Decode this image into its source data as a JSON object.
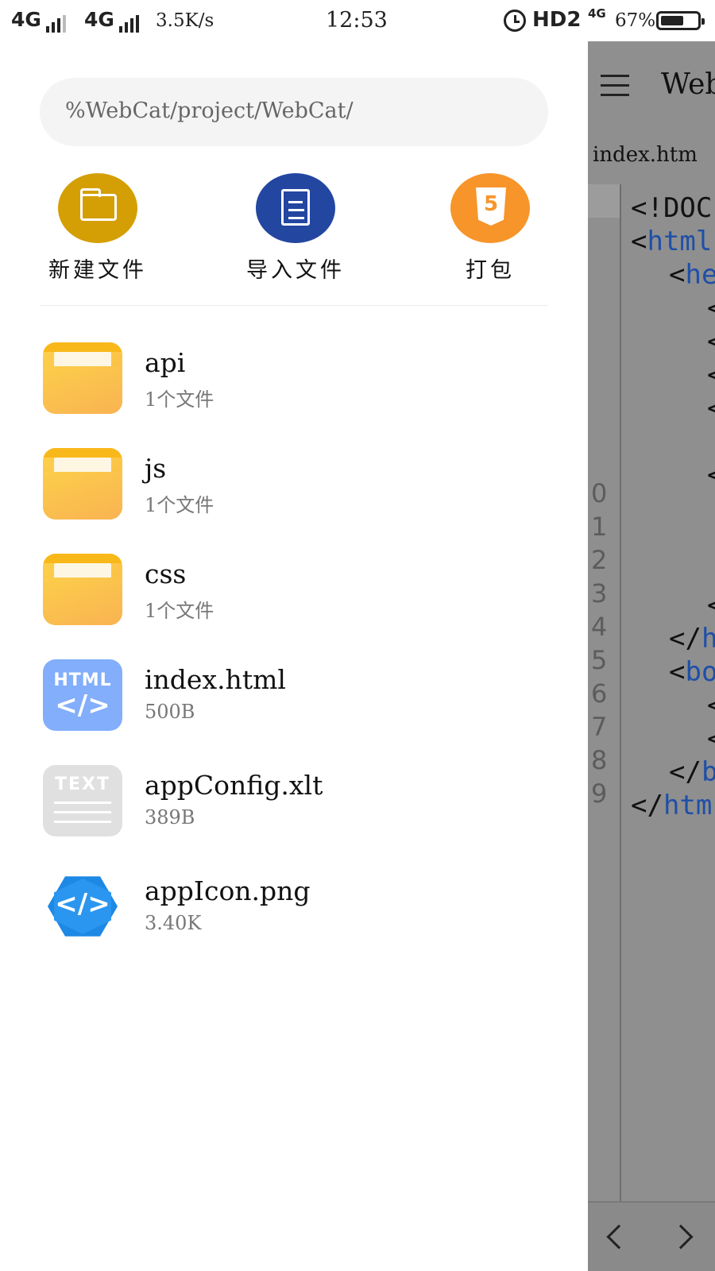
{
  "status_bar": {
    "network_left": "4G",
    "network_right": "4G",
    "speed": "3.5K/s",
    "time": "12:53",
    "hd_label": "HD2",
    "net_small": "4G",
    "battery": "67%"
  },
  "editor": {
    "title": "Web",
    "tab": "index.htm",
    "code_lines": [
      {
        "text": "<!DOC",
        "kind": "plain"
      },
      {
        "text": "<html",
        "kind": "tag"
      },
      {
        "text": "<he",
        "kind": "tag"
      },
      {
        "text": "<",
        "kind": "plain"
      },
      {
        "text": "<",
        "kind": "plain"
      },
      {
        "text": "<",
        "kind": "plain"
      },
      {
        "text": "<",
        "kind": "plain"
      },
      {
        "text": "<",
        "kind": "plain"
      },
      {
        "text": "<",
        "kind": "plain"
      },
      {
        "text": "</h",
        "kind": "tag"
      },
      {
        "text": "<bo",
        "kind": "tag"
      },
      {
        "text": "<",
        "kind": "plain"
      },
      {
        "text": "<",
        "kind": "plain"
      },
      {
        "text": "</b",
        "kind": "tag"
      },
      {
        "text": "</htm",
        "kind": "tag"
      }
    ],
    "line_numbers": [
      "0",
      "1",
      "2",
      "3",
      "4",
      "5",
      "6",
      "7",
      "8",
      "9"
    ]
  },
  "drawer": {
    "path": "%WebCat/project/WebCat/",
    "actions": [
      {
        "label": "新建文件",
        "icon": "folder-icon",
        "color": "#d49f04"
      },
      {
        "label": "导入文件",
        "icon": "document-icon",
        "color": "#2346a0"
      },
      {
        "label": "打包",
        "icon": "html5-icon",
        "color": "#f7952a"
      }
    ],
    "files": [
      {
        "name": "api",
        "meta": "1个文件",
        "type": "folder"
      },
      {
        "name": "js",
        "meta": "1个文件",
        "type": "folder"
      },
      {
        "name": "css",
        "meta": "1个文件",
        "type": "folder"
      },
      {
        "name": "index.html",
        "meta": "500B",
        "type": "html",
        "icon_text": "HTML",
        "icon_glyph": "</>"
      },
      {
        "name": "appConfig.xlt",
        "meta": "389B",
        "type": "text",
        "icon_text": "TEXT"
      },
      {
        "name": "appIcon.png",
        "meta": "3.40K",
        "type": "png",
        "icon_glyph": "</>"
      }
    ]
  }
}
